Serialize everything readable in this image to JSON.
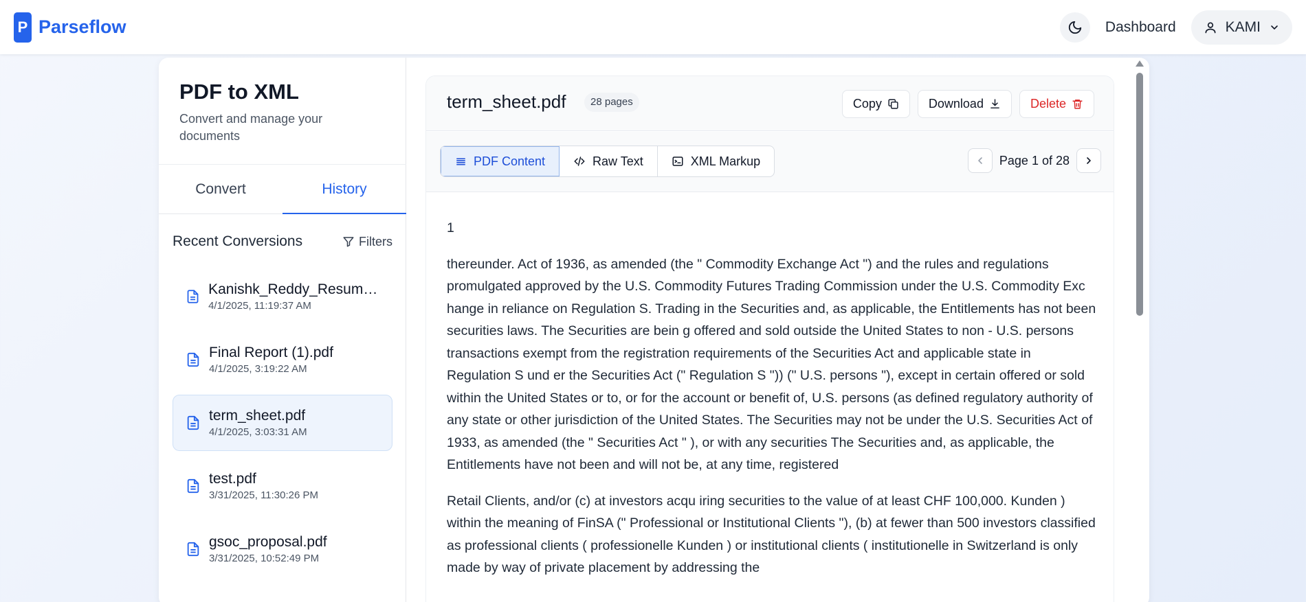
{
  "header": {
    "brand_letter": "P",
    "brand_name": "Parseflow",
    "dashboard_label": "Dashboard",
    "user_label": "KAMI"
  },
  "sidebar": {
    "title": "PDF to XML",
    "subtitle": "Convert and manage your documents",
    "tabs": [
      {
        "label": "Convert",
        "active": false
      },
      {
        "label": "History",
        "active": true
      }
    ],
    "recent_title": "Recent Conversions",
    "filters_label": "Filters",
    "files": [
      {
        "name": "Kanishk_Reddy_Resume ...",
        "date": "4/1/2025, 11:19:37 AM",
        "selected": false
      },
      {
        "name": "Final Report (1).pdf",
        "date": "4/1/2025, 3:19:22 AM",
        "selected": false
      },
      {
        "name": "term_sheet.pdf",
        "date": "4/1/2025, 3:03:31 AM",
        "selected": true
      },
      {
        "name": "test.pdf",
        "date": "3/31/2025, 11:30:26 PM",
        "selected": false
      },
      {
        "name": "gsoc_proposal.pdf",
        "date": "3/31/2025, 10:52:49 PM",
        "selected": false
      }
    ]
  },
  "document": {
    "title": "term_sheet.pdf",
    "pages_badge": "28 pages",
    "copy_label": "Copy",
    "download_label": "Download",
    "delete_label": "Delete",
    "view_tabs": [
      {
        "label": "PDF Content",
        "active": true
      },
      {
        "label": "Raw Text",
        "active": false
      },
      {
        "label": "XML Markup",
        "active": false
      }
    ],
    "page_label": "Page 1 of 28",
    "page_number": "1",
    "paragraphs": [
      "thereunder. Act of 1936, as amended (the \" Commodity Exchange Act \") and the rules and regulations promulgated approved by the U.S. Commodity Futures Trading Commission under the U.S. Commodity Exc hange in reliance on Regulation S. Trading in the Securities and, as applicable, the Entitlements has not been securities laws. The Securities are bein g offered and sold outside the United States to non - U.S. persons transactions exempt from the registration requirements of the Securities Act and applicable state in Regulation S und er the Securities Act (\" Regulation S \")) (\" U.S. persons \"), except in certain offered or sold within the United States or to, or for the account or benefit of, U.S. persons (as defined regulatory authority of any state or other jurisdiction of the United States. The Securities may not be under the U.S. Securities Act of 1933, as amended (the \" Securities Act \" ), or with any securities The Securities and, as applicable, the Entitlements have not been and will not be, at any time, registered",
      "Retail Clients, and/or (c) at investors acqu iring securities to the value of at least CHF 100,000. Kunden ) within the meaning of FinSA (\" Professional or Institutional Clients \"), (b) at fewer than 500 investors classified as professional clients ( professionelle Kunden ) or institutional clients ( institutionelle in Switzerland is only made by way of private placement by addressing the"
    ]
  },
  "colors": {
    "accent": "#2563eb",
    "danger": "#dc2626",
    "selected_bg": "#eef4fd"
  }
}
